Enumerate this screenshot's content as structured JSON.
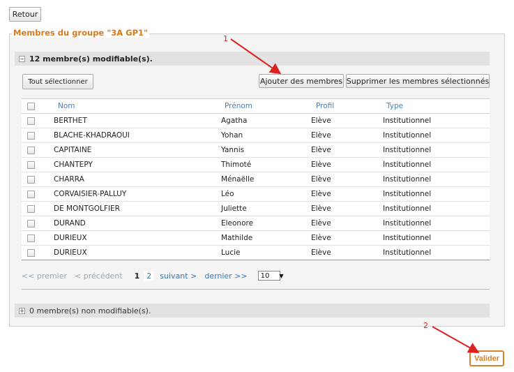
{
  "back_label": "Retour",
  "group_legend": "Membres du groupe \"3A GP1\"",
  "editable_section": {
    "title": "12 membre(s) modifiable(s)."
  },
  "toolbar": {
    "select_all": "Tout sélectionner",
    "add_members": "Ajouter des membres",
    "delete_selected": "Supprimer les membres sélectionnés"
  },
  "table": {
    "columns": [
      "Nom",
      "Prénom",
      "Profil",
      "Type"
    ],
    "rows": [
      [
        "BERTHET",
        "Agatha",
        "Elève",
        "Institutionnel"
      ],
      [
        "BLACHE-KHADRAOUI",
        "Yohan",
        "Elève",
        "Institutionnel"
      ],
      [
        "CAPITAINE",
        "Yannis",
        "Elève",
        "Institutionnel"
      ],
      [
        "CHANTEPY",
        "Thimoté",
        "Elève",
        "Institutionnel"
      ],
      [
        "CHARRA",
        "Ménaëlle",
        "Elève",
        "Institutionnel"
      ],
      [
        "CORVAISIER-PALLUY",
        "Léo",
        "Elève",
        "Institutionnel"
      ],
      [
        "DE MONTGOLFIER",
        "Juliette",
        "Elève",
        "Institutionnel"
      ],
      [
        "DURAND",
        "Eleonore",
        "Elève",
        "Institutionnel"
      ],
      [
        "DURIEUX",
        "Mathilde",
        "Elève",
        "Institutionnel"
      ],
      [
        "DURIEUX",
        "Lucie",
        "Elève",
        "Institutionnel"
      ]
    ]
  },
  "pagination": {
    "first": "<< premier",
    "previous": "< précédent",
    "current_page": "1",
    "other_page": "2",
    "next": "suivant >",
    "last": "dernier >>",
    "page_size": "10"
  },
  "non_editable_section": {
    "title": "0 membre(s) non modifiable(s)."
  },
  "submit_label": "Valider",
  "annotations": {
    "one": "1",
    "two": "2"
  },
  "colors": {
    "accent_orange": "#d9822b",
    "link_blue": "#3a78b5",
    "annotation_red": "#e02020"
  }
}
